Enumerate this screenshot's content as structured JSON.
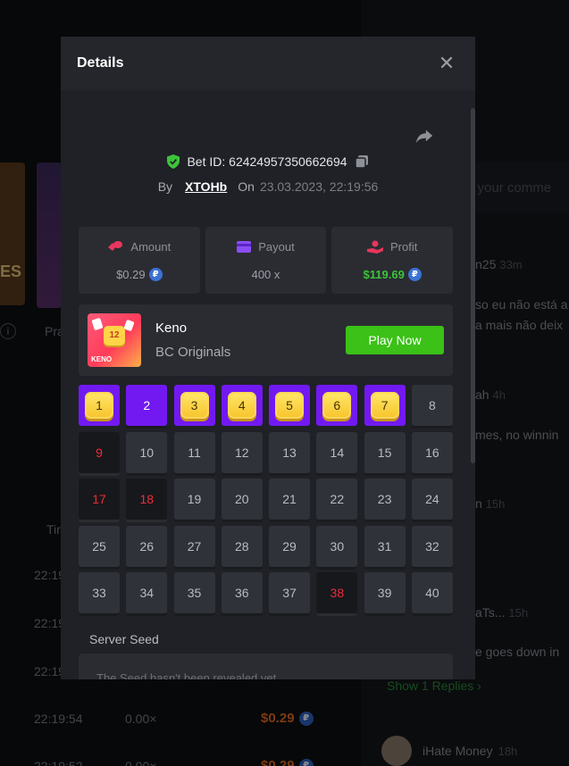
{
  "background": {
    "left_card_text": "ES",
    "prag_text": "Pra",
    "table_header": "Tin",
    "rows": [
      {
        "time": "22:19",
        "mult": "",
        "amount": ""
      },
      {
        "time": "22:19",
        "mult": "",
        "amount": ""
      },
      {
        "time": "22:19",
        "mult": "",
        "amount": ""
      },
      {
        "time": "22:19:54",
        "mult": "0.00×",
        "amount": "$0.29"
      },
      {
        "time": "22:19:52",
        "mult": "0.00×",
        "amount": "$0.29"
      }
    ],
    "comment_placeholder": "e your comme",
    "comments": [
      {
        "user": "n25",
        "time": "33m",
        "line1": "so eu não está a",
        "line2": "a mais não deix"
      },
      {
        "user": "ah",
        "time": "4h",
        "line1": "mes, no winnin"
      },
      {
        "user": "n",
        "time": "15h"
      },
      {
        "user": "aTs...",
        "time": "15h",
        "line1": "e goes down in"
      }
    ],
    "show_replies": "Show 1 Replies",
    "last_comment_user": "iHate Money",
    "last_comment_time": "18h"
  },
  "modal": {
    "title": "Details",
    "close_icon": "close-icon",
    "bet_id": "Bet ID: 62424957350662694",
    "by_label": "By",
    "username": "XTOHb",
    "on_label": "On",
    "date": "23.03.2023, 22:19:56",
    "stats": {
      "amount_label": "Amount",
      "amount_value": "$0.29",
      "payout_label": "Payout",
      "payout_value": "400 x",
      "profit_label": "Profit",
      "profit_value": "$119.69",
      "coin_symbol": "₽"
    },
    "game": {
      "name": "Keno",
      "provider": "BC Originals",
      "thumb_number": "12",
      "thumb_label": "KENO",
      "play_label": "Play Now"
    },
    "grid": [
      {
        "n": "1",
        "state": "hit"
      },
      {
        "n": "2",
        "state": "selected"
      },
      {
        "n": "3",
        "state": "hit"
      },
      {
        "n": "4",
        "state": "hit"
      },
      {
        "n": "5",
        "state": "hit"
      },
      {
        "n": "6",
        "state": "hit"
      },
      {
        "n": "7",
        "state": "hit"
      },
      {
        "n": "8",
        "state": "none"
      },
      {
        "n": "9",
        "state": "miss"
      },
      {
        "n": "10",
        "state": "none"
      },
      {
        "n": "11",
        "state": "none"
      },
      {
        "n": "12",
        "state": "none"
      },
      {
        "n": "13",
        "state": "none"
      },
      {
        "n": "14",
        "state": "none"
      },
      {
        "n": "15",
        "state": "none"
      },
      {
        "n": "16",
        "state": "none"
      },
      {
        "n": "17",
        "state": "miss"
      },
      {
        "n": "18",
        "state": "miss"
      },
      {
        "n": "19",
        "state": "none"
      },
      {
        "n": "20",
        "state": "none"
      },
      {
        "n": "21",
        "state": "none"
      },
      {
        "n": "22",
        "state": "none"
      },
      {
        "n": "23",
        "state": "none"
      },
      {
        "n": "24",
        "state": "none"
      },
      {
        "n": "25",
        "state": "none"
      },
      {
        "n": "26",
        "state": "none"
      },
      {
        "n": "27",
        "state": "none"
      },
      {
        "n": "28",
        "state": "none"
      },
      {
        "n": "29",
        "state": "none"
      },
      {
        "n": "30",
        "state": "none"
      },
      {
        "n": "31",
        "state": "none"
      },
      {
        "n": "32",
        "state": "none"
      },
      {
        "n": "33",
        "state": "none"
      },
      {
        "n": "34",
        "state": "none"
      },
      {
        "n": "35",
        "state": "none"
      },
      {
        "n": "36",
        "state": "none"
      },
      {
        "n": "37",
        "state": "none"
      },
      {
        "n": "38",
        "state": "miss"
      },
      {
        "n": "39",
        "state": "none"
      },
      {
        "n": "40",
        "state": "none"
      }
    ],
    "server_seed_label": "Server Seed",
    "server_seed_value": "The Seed hasn't been revealed yet"
  },
  "colors": {
    "accent_purple": "#7219f2",
    "play_green": "#3bc117",
    "profit_green": "#3ec33a",
    "miss_red": "#ee2c3a"
  }
}
